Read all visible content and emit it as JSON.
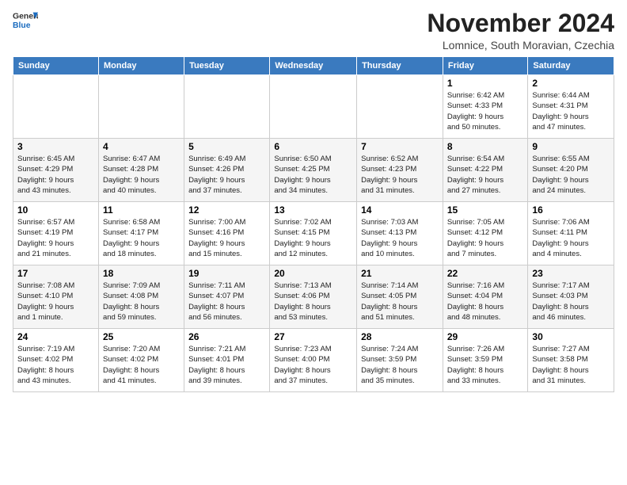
{
  "logo": {
    "line1": "General",
    "line2": "Blue"
  },
  "title": "November 2024",
  "subtitle": "Lomnice, South Moravian, Czechia",
  "days_header": [
    "Sunday",
    "Monday",
    "Tuesday",
    "Wednesday",
    "Thursday",
    "Friday",
    "Saturday"
  ],
  "weeks": [
    [
      {
        "day": "",
        "info": ""
      },
      {
        "day": "",
        "info": ""
      },
      {
        "day": "",
        "info": ""
      },
      {
        "day": "",
        "info": ""
      },
      {
        "day": "",
        "info": ""
      },
      {
        "day": "1",
        "info": "Sunrise: 6:42 AM\nSunset: 4:33 PM\nDaylight: 9 hours\nand 50 minutes."
      },
      {
        "day": "2",
        "info": "Sunrise: 6:44 AM\nSunset: 4:31 PM\nDaylight: 9 hours\nand 47 minutes."
      }
    ],
    [
      {
        "day": "3",
        "info": "Sunrise: 6:45 AM\nSunset: 4:29 PM\nDaylight: 9 hours\nand 43 minutes."
      },
      {
        "day": "4",
        "info": "Sunrise: 6:47 AM\nSunset: 4:28 PM\nDaylight: 9 hours\nand 40 minutes."
      },
      {
        "day": "5",
        "info": "Sunrise: 6:49 AM\nSunset: 4:26 PM\nDaylight: 9 hours\nand 37 minutes."
      },
      {
        "day": "6",
        "info": "Sunrise: 6:50 AM\nSunset: 4:25 PM\nDaylight: 9 hours\nand 34 minutes."
      },
      {
        "day": "7",
        "info": "Sunrise: 6:52 AM\nSunset: 4:23 PM\nDaylight: 9 hours\nand 31 minutes."
      },
      {
        "day": "8",
        "info": "Sunrise: 6:54 AM\nSunset: 4:22 PM\nDaylight: 9 hours\nand 27 minutes."
      },
      {
        "day": "9",
        "info": "Sunrise: 6:55 AM\nSunset: 4:20 PM\nDaylight: 9 hours\nand 24 minutes."
      }
    ],
    [
      {
        "day": "10",
        "info": "Sunrise: 6:57 AM\nSunset: 4:19 PM\nDaylight: 9 hours\nand 21 minutes."
      },
      {
        "day": "11",
        "info": "Sunrise: 6:58 AM\nSunset: 4:17 PM\nDaylight: 9 hours\nand 18 minutes."
      },
      {
        "day": "12",
        "info": "Sunrise: 7:00 AM\nSunset: 4:16 PM\nDaylight: 9 hours\nand 15 minutes."
      },
      {
        "day": "13",
        "info": "Sunrise: 7:02 AM\nSunset: 4:15 PM\nDaylight: 9 hours\nand 12 minutes."
      },
      {
        "day": "14",
        "info": "Sunrise: 7:03 AM\nSunset: 4:13 PM\nDaylight: 9 hours\nand 10 minutes."
      },
      {
        "day": "15",
        "info": "Sunrise: 7:05 AM\nSunset: 4:12 PM\nDaylight: 9 hours\nand 7 minutes."
      },
      {
        "day": "16",
        "info": "Sunrise: 7:06 AM\nSunset: 4:11 PM\nDaylight: 9 hours\nand 4 minutes."
      }
    ],
    [
      {
        "day": "17",
        "info": "Sunrise: 7:08 AM\nSunset: 4:10 PM\nDaylight: 9 hours\nand 1 minute."
      },
      {
        "day": "18",
        "info": "Sunrise: 7:09 AM\nSunset: 4:08 PM\nDaylight: 8 hours\nand 59 minutes."
      },
      {
        "day": "19",
        "info": "Sunrise: 7:11 AM\nSunset: 4:07 PM\nDaylight: 8 hours\nand 56 minutes."
      },
      {
        "day": "20",
        "info": "Sunrise: 7:13 AM\nSunset: 4:06 PM\nDaylight: 8 hours\nand 53 minutes."
      },
      {
        "day": "21",
        "info": "Sunrise: 7:14 AM\nSunset: 4:05 PM\nDaylight: 8 hours\nand 51 minutes."
      },
      {
        "day": "22",
        "info": "Sunrise: 7:16 AM\nSunset: 4:04 PM\nDaylight: 8 hours\nand 48 minutes."
      },
      {
        "day": "23",
        "info": "Sunrise: 7:17 AM\nSunset: 4:03 PM\nDaylight: 8 hours\nand 46 minutes."
      }
    ],
    [
      {
        "day": "24",
        "info": "Sunrise: 7:19 AM\nSunset: 4:02 PM\nDaylight: 8 hours\nand 43 minutes."
      },
      {
        "day": "25",
        "info": "Sunrise: 7:20 AM\nSunset: 4:02 PM\nDaylight: 8 hours\nand 41 minutes."
      },
      {
        "day": "26",
        "info": "Sunrise: 7:21 AM\nSunset: 4:01 PM\nDaylight: 8 hours\nand 39 minutes."
      },
      {
        "day": "27",
        "info": "Sunrise: 7:23 AM\nSunset: 4:00 PM\nDaylight: 8 hours\nand 37 minutes."
      },
      {
        "day": "28",
        "info": "Sunrise: 7:24 AM\nSunset: 3:59 PM\nDaylight: 8 hours\nand 35 minutes."
      },
      {
        "day": "29",
        "info": "Sunrise: 7:26 AM\nSunset: 3:59 PM\nDaylight: 8 hours\nand 33 minutes."
      },
      {
        "day": "30",
        "info": "Sunrise: 7:27 AM\nSunset: 3:58 PM\nDaylight: 8 hours\nand 31 minutes."
      }
    ]
  ]
}
